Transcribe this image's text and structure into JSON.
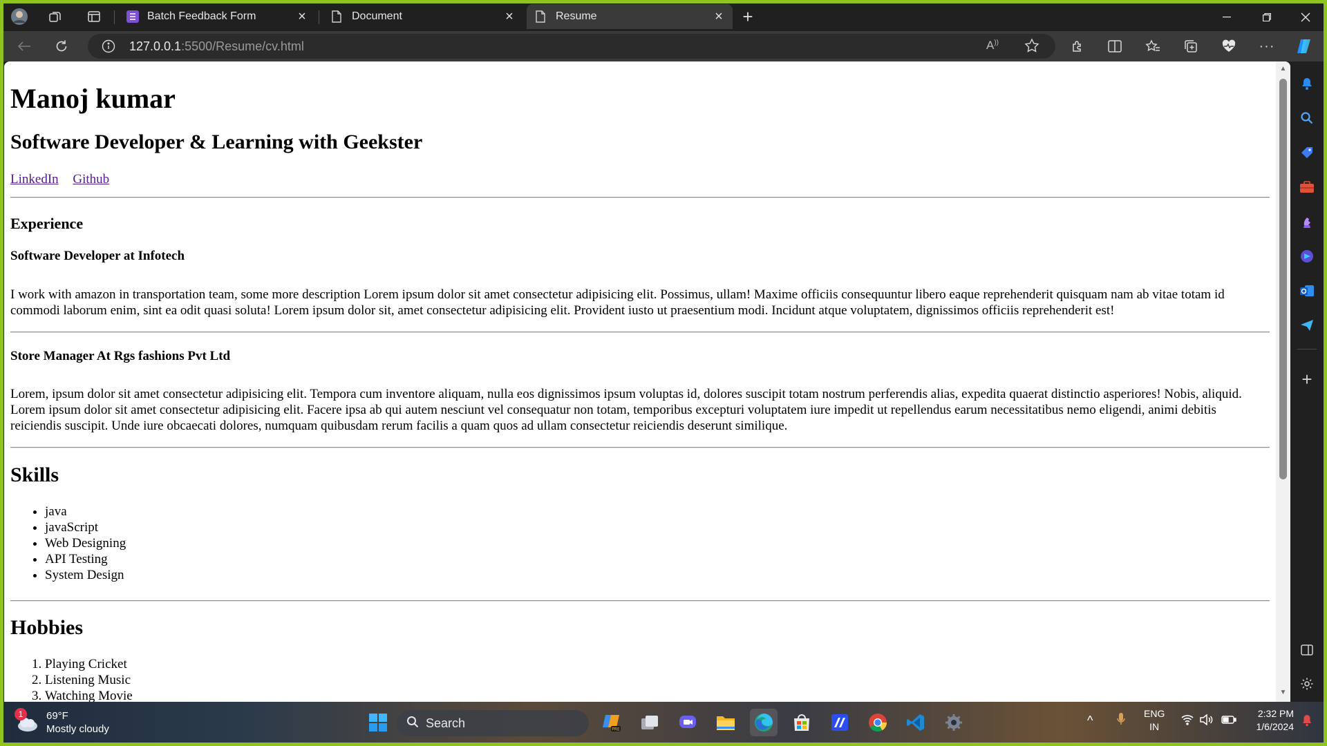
{
  "browser": {
    "tabs": [
      {
        "title": "Batch Feedback Form",
        "active": false
      },
      {
        "title": "Document",
        "active": false
      },
      {
        "title": "Resume",
        "active": true
      }
    ],
    "url_host": "127.0.0.1",
    "url_path": ":5500/Resume/cv.html"
  },
  "resume": {
    "name": "Manoj kumar",
    "tagline": "Software Developer & Learning with Geekster",
    "links": [
      {
        "label": "LinkedIn"
      },
      {
        "label": "Github"
      }
    ],
    "experience_heading": "Experience",
    "jobs": [
      {
        "title": "Software Developer at Infotech",
        "description": "I work with amazon in transportation team, some more description Lorem ipsum dolor sit amet consectetur adipisicing elit. Possimus, ullam! Maxime officiis consequuntur libero eaque reprehenderit quisquam nam ab vitae totam id commodi laborum enim, sint ea odit quasi soluta! Lorem ipsum dolor sit, amet consectetur adipisicing elit. Provident iusto ut praesentium modi. Incidunt atque voluptatem, dignissimos officiis reprehenderit est!"
      },
      {
        "title": "Store Manager At Rgs fashions Pvt Ltd",
        "description": "Lorem, ipsum dolor sit amet consectetur adipisicing elit. Tempora cum inventore aliquam, nulla eos dignissimos ipsum voluptas id, dolores suscipit totam nostrum perferendis alias, expedita quaerat distinctio asperiores! Nobis, aliquid. Lorem ipsum dolor sit amet consectetur adipisicing elit. Facere ipsa ab qui autem nesciunt vel consequatur non totam, temporibus excepturi voluptatem iure impedit ut repellendus earum necessitatibus nemo eligendi, animi debitis reiciendis suscipit. Unde iure obcaecati dolores, numquam quibusdam rerum facilis a quam quos ad ullam consectetur reiciendis deserunt similique."
      }
    ],
    "skills_heading": "Skills",
    "skills": [
      "java",
      "javaScript",
      "Web Designing",
      "API Testing",
      "System Design"
    ],
    "hobbies_heading": "Hobbies",
    "hobbies": [
      "Playing Cricket",
      "Listening Music",
      "Watching Movie"
    ]
  },
  "taskbar": {
    "weather_badge": "1",
    "temperature": "69°F",
    "condition": "Mostly cloudy",
    "search_label": "Search",
    "lang_top": "ENG",
    "lang_bottom": "IN",
    "time": "2:32 PM",
    "date": "1/6/2024"
  },
  "colors": {
    "window_border": "#8fc31f",
    "link_visited": "#551a8b",
    "chrome_dark": "#202020",
    "toolbar": "#3a3a3a"
  }
}
